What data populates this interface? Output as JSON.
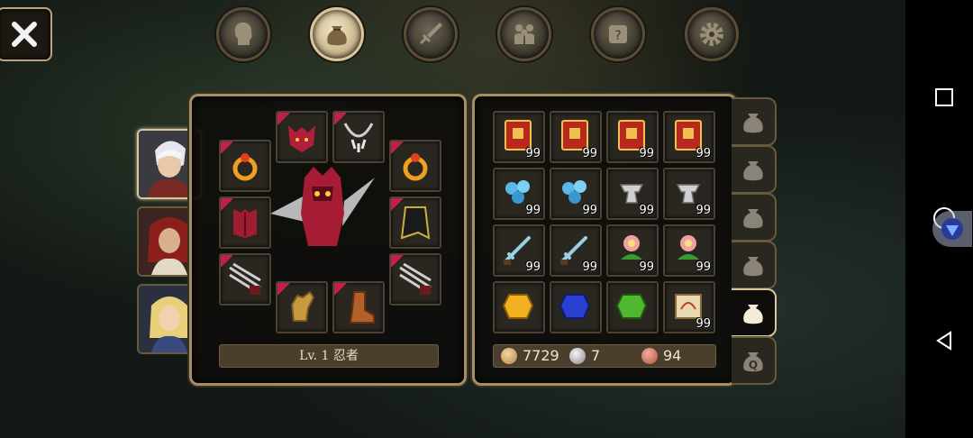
{
  "top_tabs": [
    {
      "name": "head-icon",
      "active": false
    },
    {
      "name": "bag-icon",
      "active": true
    },
    {
      "name": "sword-icon",
      "active": false
    },
    {
      "name": "party-icon",
      "active": false
    },
    {
      "name": "scroll-icon",
      "active": false
    },
    {
      "name": "gear-icon",
      "active": false
    }
  ],
  "character": {
    "level_label": "Lv. 1 忍者"
  },
  "equipment_slots": [
    "ring-icon",
    "helmet-icon",
    "necklace-icon",
    "ring-icon",
    "armor-icon",
    "cape-icon",
    "claw-icon",
    "claw-icon",
    "gauntlet-icon",
    "boots-icon"
  ],
  "inventory": [
    {
      "icon": "spellbook-icon",
      "qty": "99"
    },
    {
      "icon": "spellbook-icon",
      "qty": "99"
    },
    {
      "icon": "spellbook-icon",
      "qty": "99"
    },
    {
      "icon": "spellbook-icon",
      "qty": "99"
    },
    {
      "icon": "blue-orbs-icon",
      "qty": "99"
    },
    {
      "icon": "blue-orbs-icon",
      "qty": "99"
    },
    {
      "icon": "anvil-icon",
      "qty": "99"
    },
    {
      "icon": "anvil-icon",
      "qty": "99"
    },
    {
      "icon": "bone-dagger-icon",
      "qty": "99"
    },
    {
      "icon": "bone-dagger-icon",
      "qty": "99"
    },
    {
      "icon": "flower-icon",
      "qty": "99"
    },
    {
      "icon": "flower-icon",
      "qty": "99"
    },
    {
      "icon": "amber-gem-icon",
      "qty": ""
    },
    {
      "icon": "sapphire-gem-icon",
      "qty": ""
    },
    {
      "icon": "emerald-gem-icon",
      "qty": ""
    },
    {
      "icon": "scroll-map-icon",
      "qty": "99"
    }
  ],
  "currency": {
    "gold": "7729",
    "silver": "7",
    "copper": "94"
  },
  "side_tabs": [
    {
      "name": "bag-tab-1",
      "active": false
    },
    {
      "name": "bag-tab-2",
      "active": false
    },
    {
      "name": "bag-tab-3",
      "active": false
    },
    {
      "name": "bag-tab-4",
      "active": false
    },
    {
      "name": "bag-tab-5",
      "active": true
    },
    {
      "name": "quest-bag-tab",
      "active": false,
      "label": "Q"
    }
  ],
  "colors": {
    "panel_border": "#a48f66",
    "accent_red": "#c0204a",
    "text": "#e6dcc2"
  }
}
